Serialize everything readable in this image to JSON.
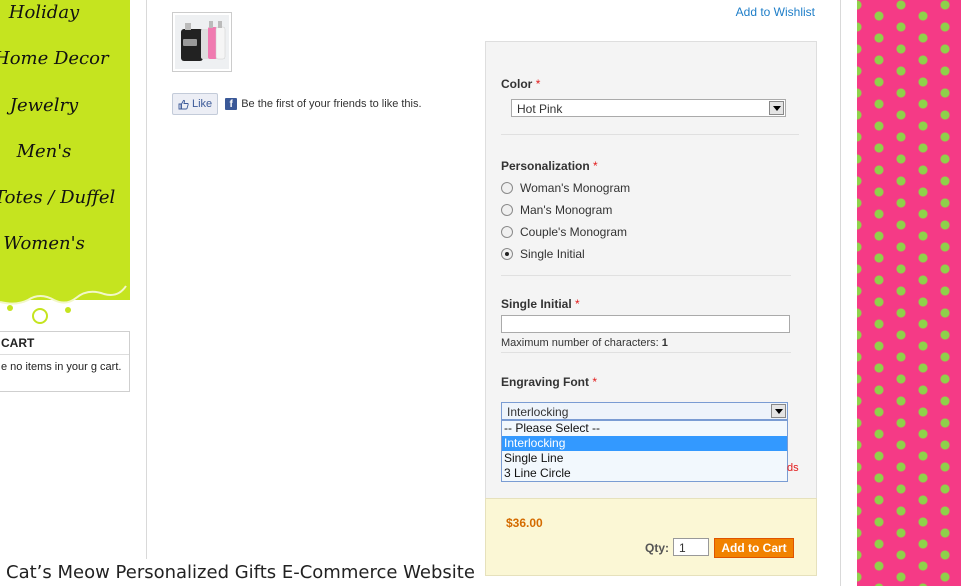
{
  "nav": {
    "items": [
      "Holiday",
      "Home Decor",
      "Jewelry",
      "Men's",
      "Totes / Duffel",
      "Women's"
    ]
  },
  "cart": {
    "title": "CART",
    "message": "e no items in your g cart."
  },
  "product": {
    "wishlist_label": "Add to Wishlist",
    "like_label": "Like",
    "like_text": "Be the first of your friends to like this."
  },
  "options": {
    "color": {
      "label": "Color",
      "value": "Hot Pink"
    },
    "personalization": {
      "label": "Personalization",
      "choices": [
        "Woman's Monogram",
        "Man's Monogram",
        "Couple's Monogram",
        "Single Initial"
      ],
      "selected": "Single Initial"
    },
    "single_initial": {
      "label": "Single Initial",
      "value": "",
      "hint_prefix": "Maximum number of characters:",
      "hint_value": "1"
    },
    "engraving_font": {
      "label": "Engraving Font",
      "value": "Interlocking",
      "options": [
        "-- Please Select --",
        "Interlocking",
        "Single Line",
        "3 Line Circle"
      ],
      "highlighted": "Interlocking"
    },
    "partial_text": "ds",
    "required_mark": "*"
  },
  "purchase": {
    "price": "$36.00",
    "qty_label": "Qty:",
    "qty_value": "1",
    "add_to_cart_label": "Add to Cart"
  },
  "caption": "Cat’s Meow Personalized Gifts E-Commerce Website",
  "colors": {
    "sidebar_green": "#c5e41f",
    "polka_pink": "#f53a86",
    "polka_dot_green": "#8fd14a",
    "link_blue": "#1e7ec8",
    "price_orange": "#d46b00",
    "button_orange": "#f18200",
    "required_red": "#e21b1b"
  }
}
